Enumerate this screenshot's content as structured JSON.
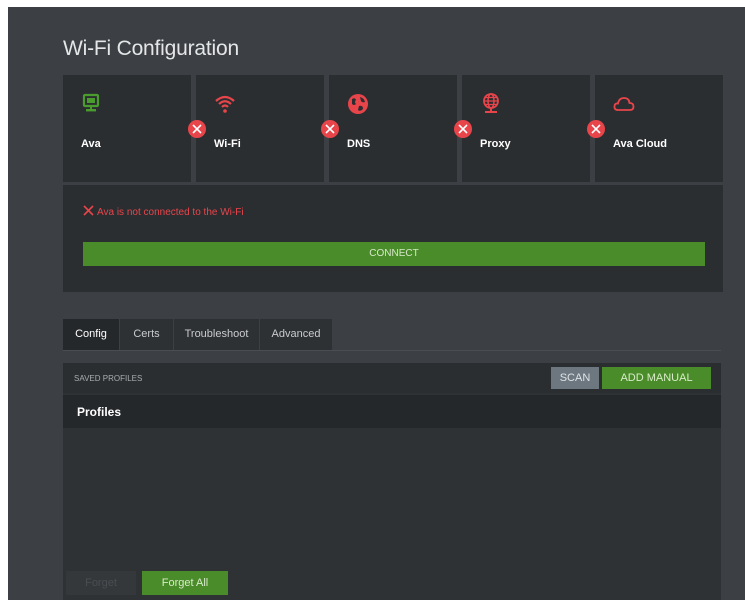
{
  "title": "Wi-Fi Configuration",
  "steps": [
    {
      "label": "Ava",
      "icon": "monitor-icon",
      "color": "#4a9c2f"
    },
    {
      "label": "Wi-Fi",
      "icon": "wifi-icon",
      "color": "#e8454b"
    },
    {
      "label": "DNS",
      "icon": "globe-icon",
      "color": "#e8454b"
    },
    {
      "label": "Proxy",
      "icon": "network-globe-icon",
      "color": "#e8454b"
    },
    {
      "label": "Ava Cloud",
      "icon": "cloud-icon",
      "color": "#e8454b"
    }
  ],
  "status": {
    "message": "Ava is not connected to the Wi-Fi",
    "connect_label": "CONNECT"
  },
  "tabs": [
    {
      "label": "Config",
      "active": true
    },
    {
      "label": "Certs",
      "active": false
    },
    {
      "label": "Troubleshoot",
      "active": false
    },
    {
      "label": "Advanced",
      "active": false
    }
  ],
  "profiles": {
    "caption": "SAVED PROFILES",
    "scan_label": "SCAN",
    "add_manual_label": "ADD MANUAL",
    "header": "Profiles",
    "forget_label": "Forget",
    "forget_all_label": "Forget All"
  },
  "colors": {
    "background": "#3c3f43",
    "panel": "#2b2e31",
    "accent_green": "#4a8c2a",
    "error_red": "#e8454b"
  }
}
